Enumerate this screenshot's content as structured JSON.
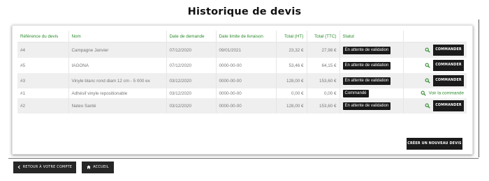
{
  "page_title": "Historique de devis",
  "table": {
    "headers": [
      "Référence du devis",
      "Nom",
      "Date de demande",
      "Date limite de livraison",
      "Total (HT)",
      "Total (TTC)",
      "Statut",
      ""
    ],
    "rows": [
      {
        "ref": "#4",
        "name": "Campagne Janvier",
        "date": "07/12/2020",
        "deadline": "09/01/2021",
        "ht": "23,32 €",
        "ttc": "27,98 €",
        "status": "En attente de validation",
        "action": "COMMANDER"
      },
      {
        "ref": "#5",
        "name": "IAGONA",
        "date": "07/12/2020",
        "deadline": "0000-00-00",
        "ht": "53,46 €",
        "ttc": "64,15 €",
        "status": "En attente de validation",
        "action": "COMMANDER"
      },
      {
        "ref": "#3",
        "name": "Vinyle blanc rond diam 12 cm - 5 000 ex",
        "date": "03/12/2020",
        "deadline": "0000-00-00",
        "ht": "128,00 €",
        "ttc": "153,60 €",
        "status": "En attente de validation",
        "action": "COMMANDER"
      },
      {
        "ref": "#1",
        "name": "Adhésif vinyle repositionable",
        "date": "03/12/2020",
        "deadline": "0000-00-00",
        "ht": "0,00 €",
        "ttc": "0,00 €",
        "status": "Commandé",
        "action": "Voir la commande"
      },
      {
        "ref": "#2",
        "name": "Nateo Santé",
        "date": "03/12/2020",
        "deadline": "0000-00-00",
        "ht": "128,00 €",
        "ttc": "153,60 €",
        "status": "En attente de validation",
        "action": "COMMANDER"
      }
    ]
  },
  "new_quote_button": "CRÉER UN NOUVEAU DEVIS",
  "back_button": "RETOUR À VOTRE COMPTE",
  "home_button": "ACCUEIL",
  "icons": {
    "action": "search-icon",
    "back": "chevron-left-icon",
    "home": "home-icon"
  },
  "colors": {
    "accent": "#2e8b2e",
    "button": "#1b1b1b"
  }
}
